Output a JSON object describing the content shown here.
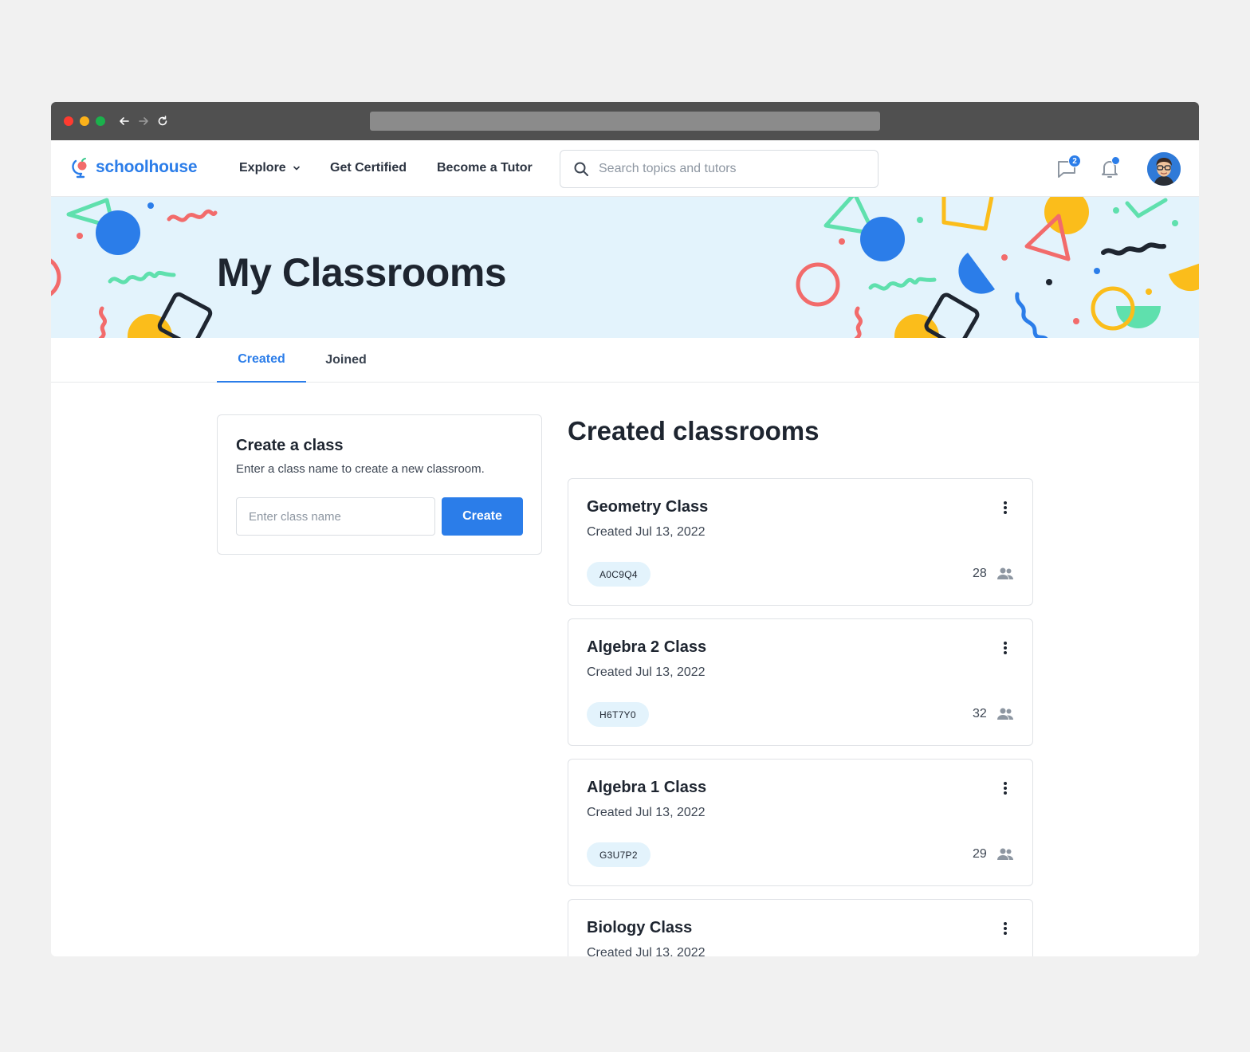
{
  "app": {
    "brand": "schoolhouse"
  },
  "nav": {
    "links": [
      "Explore",
      "Get Certified",
      "Become a Tutor"
    ],
    "search_placeholder": "Search topics and tutors",
    "message_count": "2"
  },
  "hero": {
    "title": "My Classrooms"
  },
  "tabs": [
    {
      "label": "Created",
      "active": true
    },
    {
      "label": "Joined",
      "active": false
    }
  ],
  "create": {
    "title": "Create a class",
    "subtitle": "Enter a class name to create a new classroom.",
    "input_placeholder": "Enter class name",
    "button_label": "Create"
  },
  "classrooms": {
    "title": "Created classrooms",
    "items": [
      {
        "name": "Geometry Class",
        "created": "Created Jul 13, 2022",
        "code": "A0C9Q4",
        "members": "28"
      },
      {
        "name": "Algebra 2 Class",
        "created": "Created Jul 13, 2022",
        "code": "H6T7Y0",
        "members": "32"
      },
      {
        "name": "Algebra 1 Class",
        "created": "Created Jul 13, 2022",
        "code": "G3U7P2",
        "members": "29"
      },
      {
        "name": "Biology Class",
        "created": "Created Jul 13, 2022"
      }
    ]
  },
  "colors": {
    "accent": "#2b7de9",
    "hero_bg": "#e3f3fc",
    "text": "#1e2530"
  },
  "icons": [
    "back-arrow-icon",
    "forward-arrow-icon",
    "reload-icon",
    "search-icon",
    "chevron-down-icon",
    "message-icon",
    "bell-icon",
    "more-vertical-icon",
    "people-icon"
  ]
}
